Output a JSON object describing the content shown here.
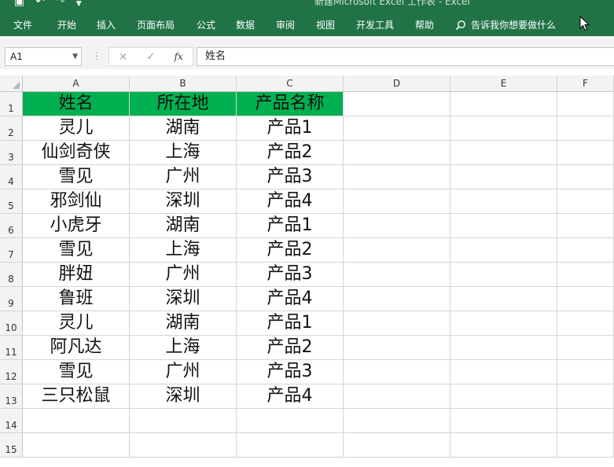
{
  "window": {
    "title": "新建Microsoft Excel 工作表 - Excel",
    "qat_icons": [
      "save-icon",
      "undo-icon",
      "redo-icon",
      "customize-qat-icon"
    ]
  },
  "ribbon": {
    "tabs": [
      "文件",
      "开始",
      "插入",
      "页面布局",
      "公式",
      "数据",
      "审阅",
      "视图",
      "开发工具",
      "帮助"
    ],
    "tell_me": "告诉我你想要做什么"
  },
  "formula_bar": {
    "name_box": "A1",
    "cancel_symbol": "×",
    "enter_symbol": "✓",
    "fx_label": "fx",
    "content": "姓名"
  },
  "sheet": {
    "columns": [
      "A",
      "B",
      "C",
      "D",
      "E",
      "F"
    ],
    "rows": [
      "1",
      "2",
      "3",
      "4",
      "5",
      "6",
      "7",
      "8",
      "9",
      "10",
      "11",
      "12",
      "13",
      "14",
      "15"
    ],
    "cells": [
      [
        "姓名",
        "所在地",
        "产品名称"
      ],
      [
        "灵儿",
        "湖南",
        "产品1"
      ],
      [
        "仙剑奇侠",
        "上海",
        "产品2"
      ],
      [
        "雪见",
        "广州",
        "产品3"
      ],
      [
        "邪剑仙",
        "深圳",
        "产品4"
      ],
      [
        "小虎牙",
        "湖南",
        "产品1"
      ],
      [
        "雪见",
        "上海",
        "产品2"
      ],
      [
        "胖妞",
        "广州",
        "产品3"
      ],
      [
        "鲁班",
        "深圳",
        "产品4"
      ],
      [
        "灵儿",
        "湖南",
        "产品1"
      ],
      [
        "阿凡达",
        "上海",
        "产品2"
      ],
      [
        "雪见",
        "广州",
        "产品3"
      ],
      [
        "三只松鼠",
        "深圳",
        "产品4"
      ]
    ],
    "header_fill_color": "#00b050"
  },
  "colors": {
    "ribbon": "#217346",
    "gridline": "#d4d4d4",
    "header_bg": "#f3f3f3"
  }
}
